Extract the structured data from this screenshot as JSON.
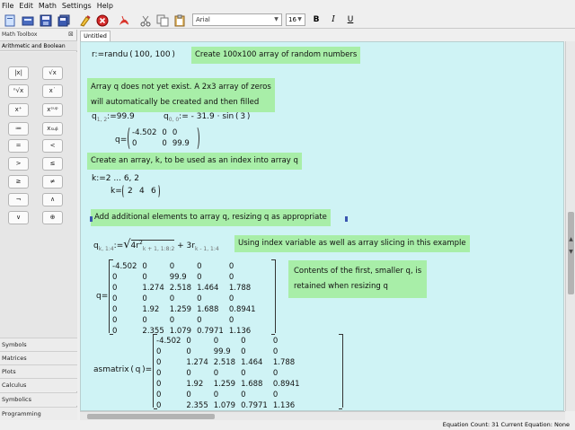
{
  "menu": [
    "File",
    "Edit",
    "Math",
    "Settings",
    "Help"
  ],
  "toolbar": {
    "font_family": "Arial",
    "font_size": "16",
    "bold": "B",
    "italic": "I",
    "underline": "U"
  },
  "left_panel": {
    "title": "Math Toolbox",
    "close_glyph": "⊠",
    "header": "Arithmetic and Boolean",
    "symbols": [
      "|x|",
      "√x",
      "ⁿ√x",
      "x˙",
      "x⁺",
      "xˢᵘᵖ",
      "≔",
      "xₛᵤᵦ",
      "=",
      "<",
      ">",
      "≤",
      "≥",
      "≠",
      "¬",
      "∧",
      "∨",
      "⊕"
    ],
    "sections": [
      "Symbols",
      "Matrices",
      "Plots",
      "Calculus",
      "Symbolics",
      "Programming"
    ]
  },
  "tab": {
    "label": "Untitled"
  },
  "worksheet": {
    "r_def": "r:=randu ( 100, 100 )",
    "note_random": "Create 100x100 array of random numbers",
    "note_q_line1": "Array q does not yet exist. A 2x3 array of zeros",
    "note_q_line2": "will automatically be created and then filled",
    "q12_lhs": "q",
    "q12_sub": "1, 2",
    "q12_rhs": ":=99.9",
    "q00_lhs": "q",
    "q00_sub": "0, 0",
    "q00_rhs": ":= - 31.9 · sin ( 3 )",
    "q_eq": "q=",
    "q_small": [
      [
        "-4.502",
        "0",
        "0"
      ],
      [
        "0",
        "0",
        "99.9"
      ]
    ],
    "note_k": "Create an array, k, to be used as an index into array q",
    "k_def": "k:=2 ... 6, 2",
    "k_eq": "k=",
    "k_values": [
      "2",
      "4",
      "6"
    ],
    "note_add": "Add additional elements to array q, resizing q as appropriate",
    "q_resize_lhs": "q",
    "q_resize_sub": "k, 1:4",
    "q_resize_assign": ":=",
    "q_resize_sqrt_inner": "4r",
    "q_resize_sqrt_sup": "2",
    "q_resize_sqrt_sub": "k + 1, 1:8:2",
    "q_resize_plus": "+ 3r",
    "q_resize_plus_sub": "k - 1, 1:4",
    "note_index": "Using index variable as well as array slicing in this example",
    "q_big_eq": "q=",
    "q_big": [
      [
        "-4.502",
        "0",
        "0",
        "0",
        "0"
      ],
      [
        "0",
        "0",
        "99.9",
        "0",
        "0"
      ],
      [
        "0",
        "1.274",
        "2.518",
        "1.464",
        "1.788"
      ],
      [
        "0",
        "0",
        "0",
        "0",
        "0"
      ],
      [
        "0",
        "1.92",
        "1.259",
        "1.688",
        "0.8941"
      ],
      [
        "0",
        "0",
        "0",
        "0",
        "0"
      ],
      [
        "0",
        "2.355",
        "1.079",
        "0.7971",
        "1.136"
      ]
    ],
    "note_contents_line1": "Contents of the first, smaller q, is",
    "note_contents_line2": "retained when resizing q",
    "asmatrix_label": "asmatrix ( q )=",
    "asmatrix": [
      [
        "-4.502",
        "0",
        "0",
        "0",
        "0"
      ],
      [
        "0",
        "0",
        "99.9",
        "0",
        "0"
      ],
      [
        "0",
        "1.274",
        "2.518",
        "1.464",
        "1.788"
      ],
      [
        "0",
        "0",
        "0",
        "0",
        "0"
      ],
      [
        "0",
        "1.92",
        "1.259",
        "1.688",
        "0.8941"
      ],
      [
        "0",
        "0",
        "0",
        "0",
        "0"
      ],
      [
        "0",
        "2.355",
        "1.079",
        "0.7971",
        "1.136"
      ]
    ]
  },
  "status": "Equation Count: 31 Current Equation: None"
}
